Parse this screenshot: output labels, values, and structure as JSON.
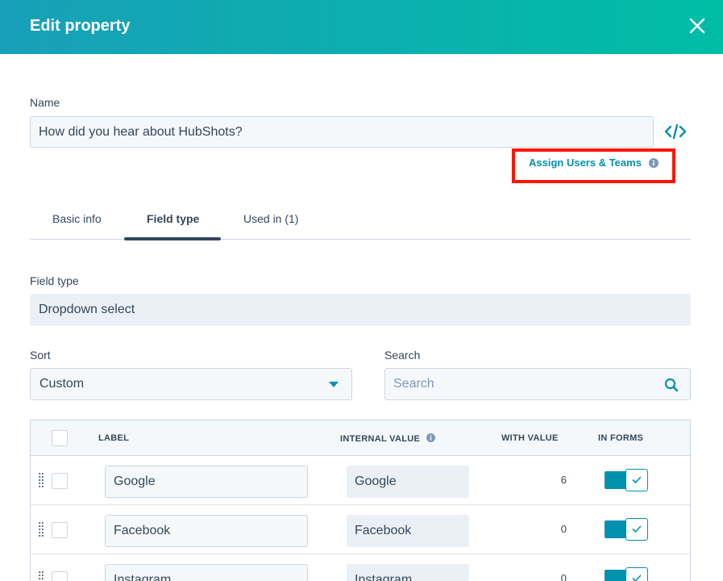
{
  "header": {
    "title": "Edit property"
  },
  "name_section": {
    "label": "Name",
    "value": "How did you hear about HubShots?"
  },
  "assign_link": {
    "label": "Assign Users & Teams"
  },
  "tabs": [
    {
      "label": "Basic info"
    },
    {
      "label": "Field type"
    },
    {
      "label": "Used in (1)"
    }
  ],
  "field_type": {
    "label": "Field type",
    "value": "Dropdown select"
  },
  "sort": {
    "label": "Sort",
    "value": "Custom"
  },
  "search": {
    "label": "Search",
    "placeholder": "Search"
  },
  "table": {
    "headers": {
      "label": "LABEL",
      "internal_value": "INTERNAL VALUE",
      "with_value": "WITH VALUE",
      "in_forms": "IN FORMS"
    },
    "rows": [
      {
        "label": "Google",
        "internal_value": "Google",
        "count": "6"
      },
      {
        "label": "Facebook",
        "internal_value": "Facebook",
        "count": "0"
      },
      {
        "label": "Instagram",
        "internal_value": "Instagram",
        "count": "0"
      }
    ]
  },
  "colors": {
    "accent": "#0091ae",
    "header_start": "#18a0b8",
    "header_end": "#00bda5",
    "highlight": "#ff1400"
  }
}
